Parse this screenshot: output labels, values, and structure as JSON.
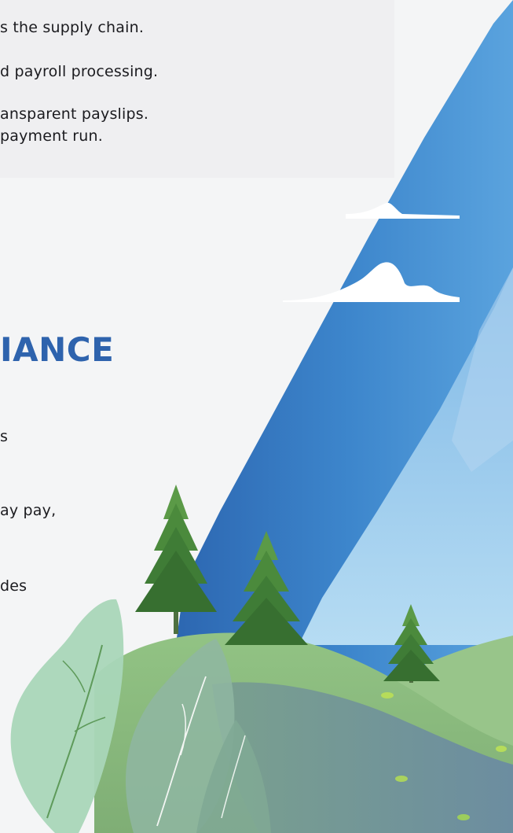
{
  "top_panel": {
    "lines": [
      "s the supply chain.",
      "d payroll processing.",
      "ansparent payslips.",
      "payment run."
    ]
  },
  "section": {
    "heading": "IANCE",
    "lines": [
      "s",
      "ay pay,",
      "des"
    ]
  },
  "colors": {
    "heading": "#2e63ad",
    "text": "#1b1b1f",
    "sky_dark": "#2a67b3",
    "sky_light": "#9fccef",
    "hill": "#8dbd7e",
    "tree": "#3f7c36"
  },
  "illustration": {
    "icons": [
      "mountain-sky-illustration",
      "cloud-icon",
      "pine-tree-icon",
      "leaf-icon"
    ]
  }
}
